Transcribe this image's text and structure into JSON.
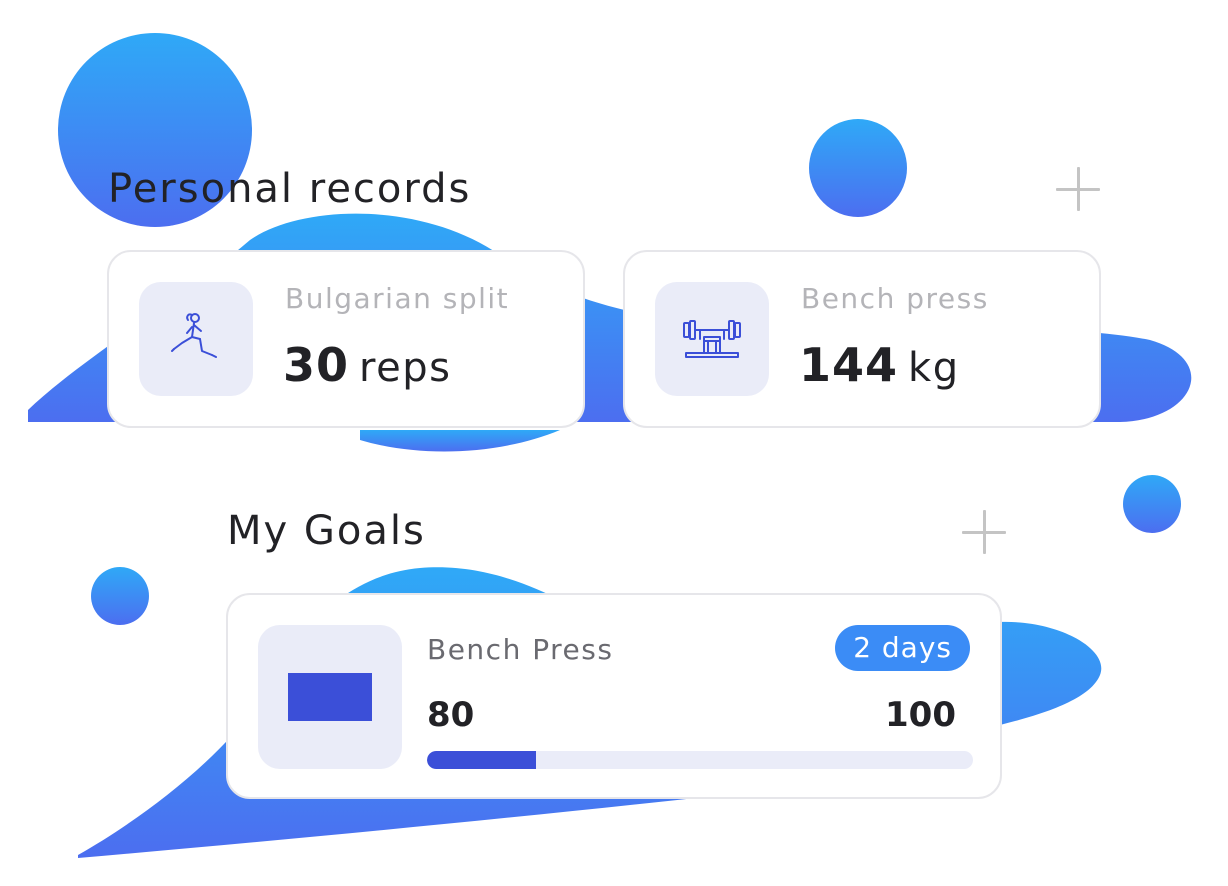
{
  "colors": {
    "accent": "#3b8cf6",
    "progress": "#3b4fd8",
    "icon_bg": "#eaecf8",
    "blob_top": "#2fa6f6",
    "blob_bottom": "#4a72f0"
  },
  "records": {
    "title": "Personal records",
    "items": [
      {
        "name": "Bulgarian split",
        "value": "30",
        "unit": "reps",
        "icon": "lunge-exercise-icon"
      },
      {
        "name": "Bench press",
        "value": "144",
        "unit": "kg",
        "icon": "bench-press-icon"
      }
    ]
  },
  "goals": {
    "title": "My Goals",
    "items": [
      {
        "name": "Bench Press",
        "badge": "2 days",
        "current": "80",
        "target": "100",
        "progress": 0.2,
        "icon": "goal-thumbnail"
      }
    ]
  }
}
